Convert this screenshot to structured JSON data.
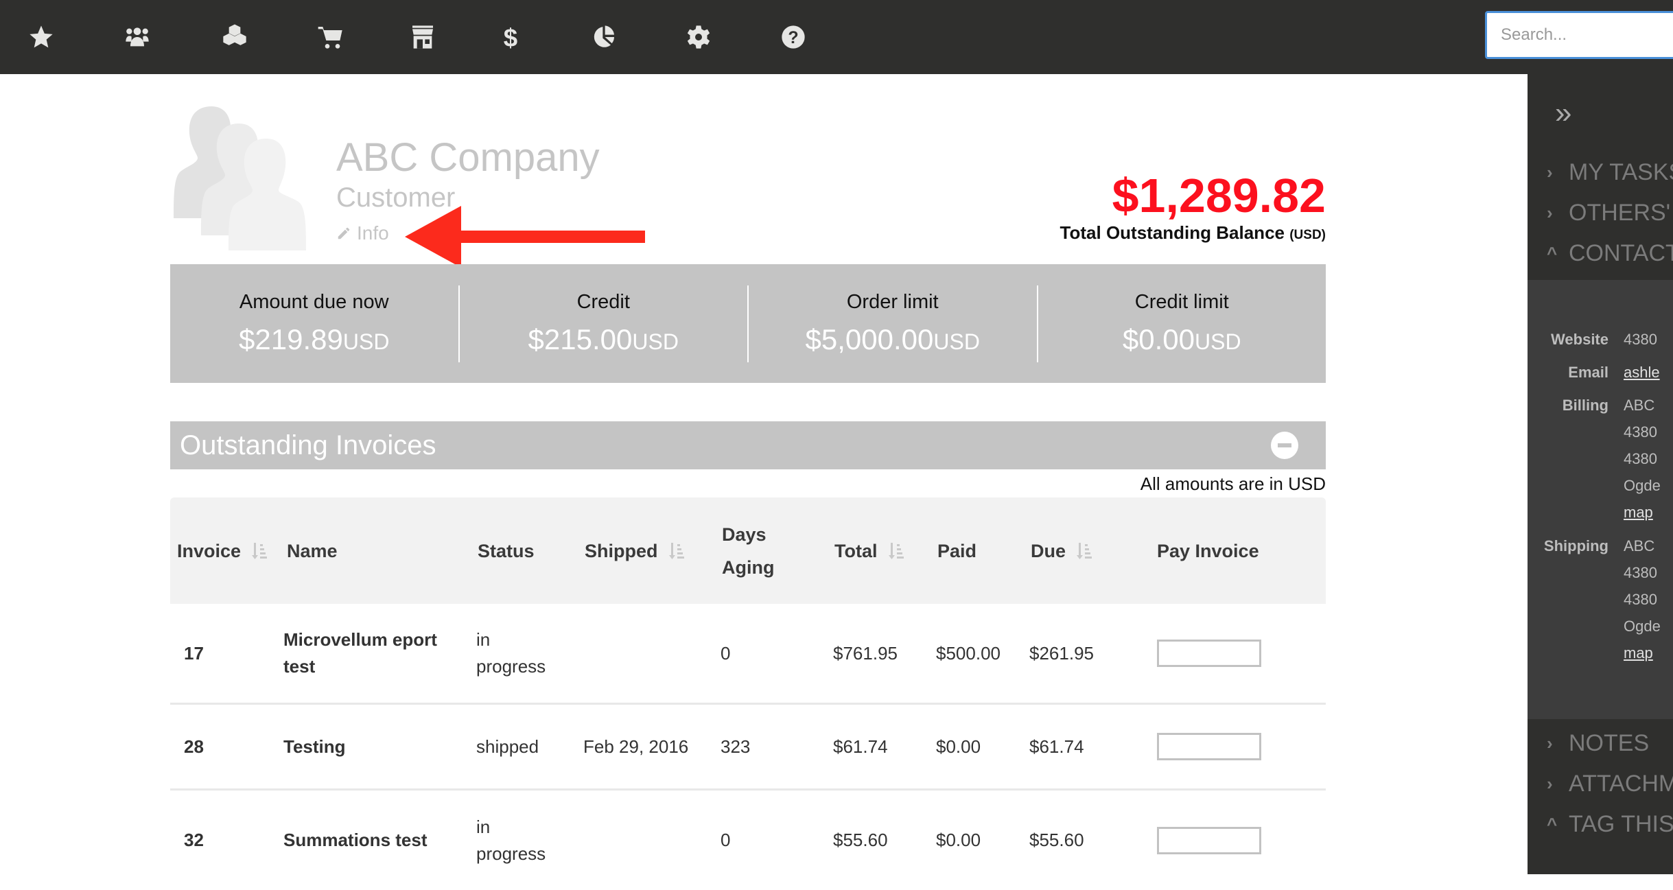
{
  "topbar": {
    "icons": [
      "star-icon",
      "users-icon",
      "cubes-icon",
      "cart-icon",
      "store-icon",
      "dollar-icon",
      "pie-chart-icon",
      "gear-icon",
      "help-icon"
    ],
    "search_placeholder": "Search..."
  },
  "sidebar": {
    "expand_icon": "»",
    "items_top": [
      {
        "chev": "›",
        "label": "MY TASKS"
      },
      {
        "chev": "›",
        "label": "OTHERS' T"
      },
      {
        "chev": "^",
        "label": "CONTACT"
      }
    ],
    "contact": [
      {
        "label": "Website",
        "lines": [
          "4380"
        ],
        "link": false
      },
      {
        "label": "Email",
        "lines": [
          "ashle"
        ],
        "link": true
      },
      {
        "label": "Billing",
        "lines": [
          "ABC",
          "4380",
          "4380",
          "Ogde"
        ],
        "link": false,
        "map": "map"
      },
      {
        "label": "Shipping",
        "lines": [
          "ABC",
          "4380",
          "4380",
          "Ogde"
        ],
        "link": false,
        "map": "map"
      }
    ],
    "items_bottom": [
      {
        "chev": "›",
        "label": "NOTES"
      },
      {
        "chev": "›",
        "label": "ATTACHM"
      },
      {
        "chev": "^",
        "label": "TAG THIS"
      }
    ]
  },
  "profile": {
    "company": "ABC Company",
    "type": "Customer",
    "info_label": "Info"
  },
  "balance": {
    "amount": "$1,289.82",
    "label": "Total Outstanding Balance",
    "currency": "(USD)"
  },
  "summary": [
    {
      "label": "Amount due now",
      "value": "$219.89",
      "currency": "USD"
    },
    {
      "label": "Credit",
      "value": "$215.00",
      "currency": "USD"
    },
    {
      "label": "Order limit",
      "value": "$5,000.00",
      "currency": "USD"
    },
    {
      "label": "Credit limit",
      "value": "$0.00",
      "currency": "USD"
    }
  ],
  "invoices": {
    "title": "Outstanding Invoices",
    "note": "All amounts are in USD",
    "columns": [
      "Invoice",
      "Name",
      "Status",
      "Shipped",
      "Days Aging",
      "Total",
      "Paid",
      "Due",
      "Pay Invoice"
    ],
    "rows": [
      {
        "invoice": "17",
        "name": "Microvellum eport test",
        "status": "in progress",
        "shipped": "",
        "days": "0",
        "total": "$761.95",
        "paid": "$500.00",
        "due": "$261.95",
        "pay": ""
      },
      {
        "invoice": "28",
        "name": "Testing",
        "status": "shipped",
        "shipped": "Feb 29, 2016",
        "days": "323",
        "total": "$61.74",
        "paid": "$0.00",
        "due": "$61.74",
        "pay": ""
      },
      {
        "invoice": "32",
        "name": "Summations test",
        "status": "in progress",
        "shipped": "",
        "days": "0",
        "total": "$55.60",
        "paid": "$0.00",
        "due": "$55.60",
        "pay": ""
      }
    ]
  },
  "colors": {
    "accent_red": "#fc101e",
    "topbar": "#2f2f2d",
    "panel_gray": "#c4c4c4"
  }
}
